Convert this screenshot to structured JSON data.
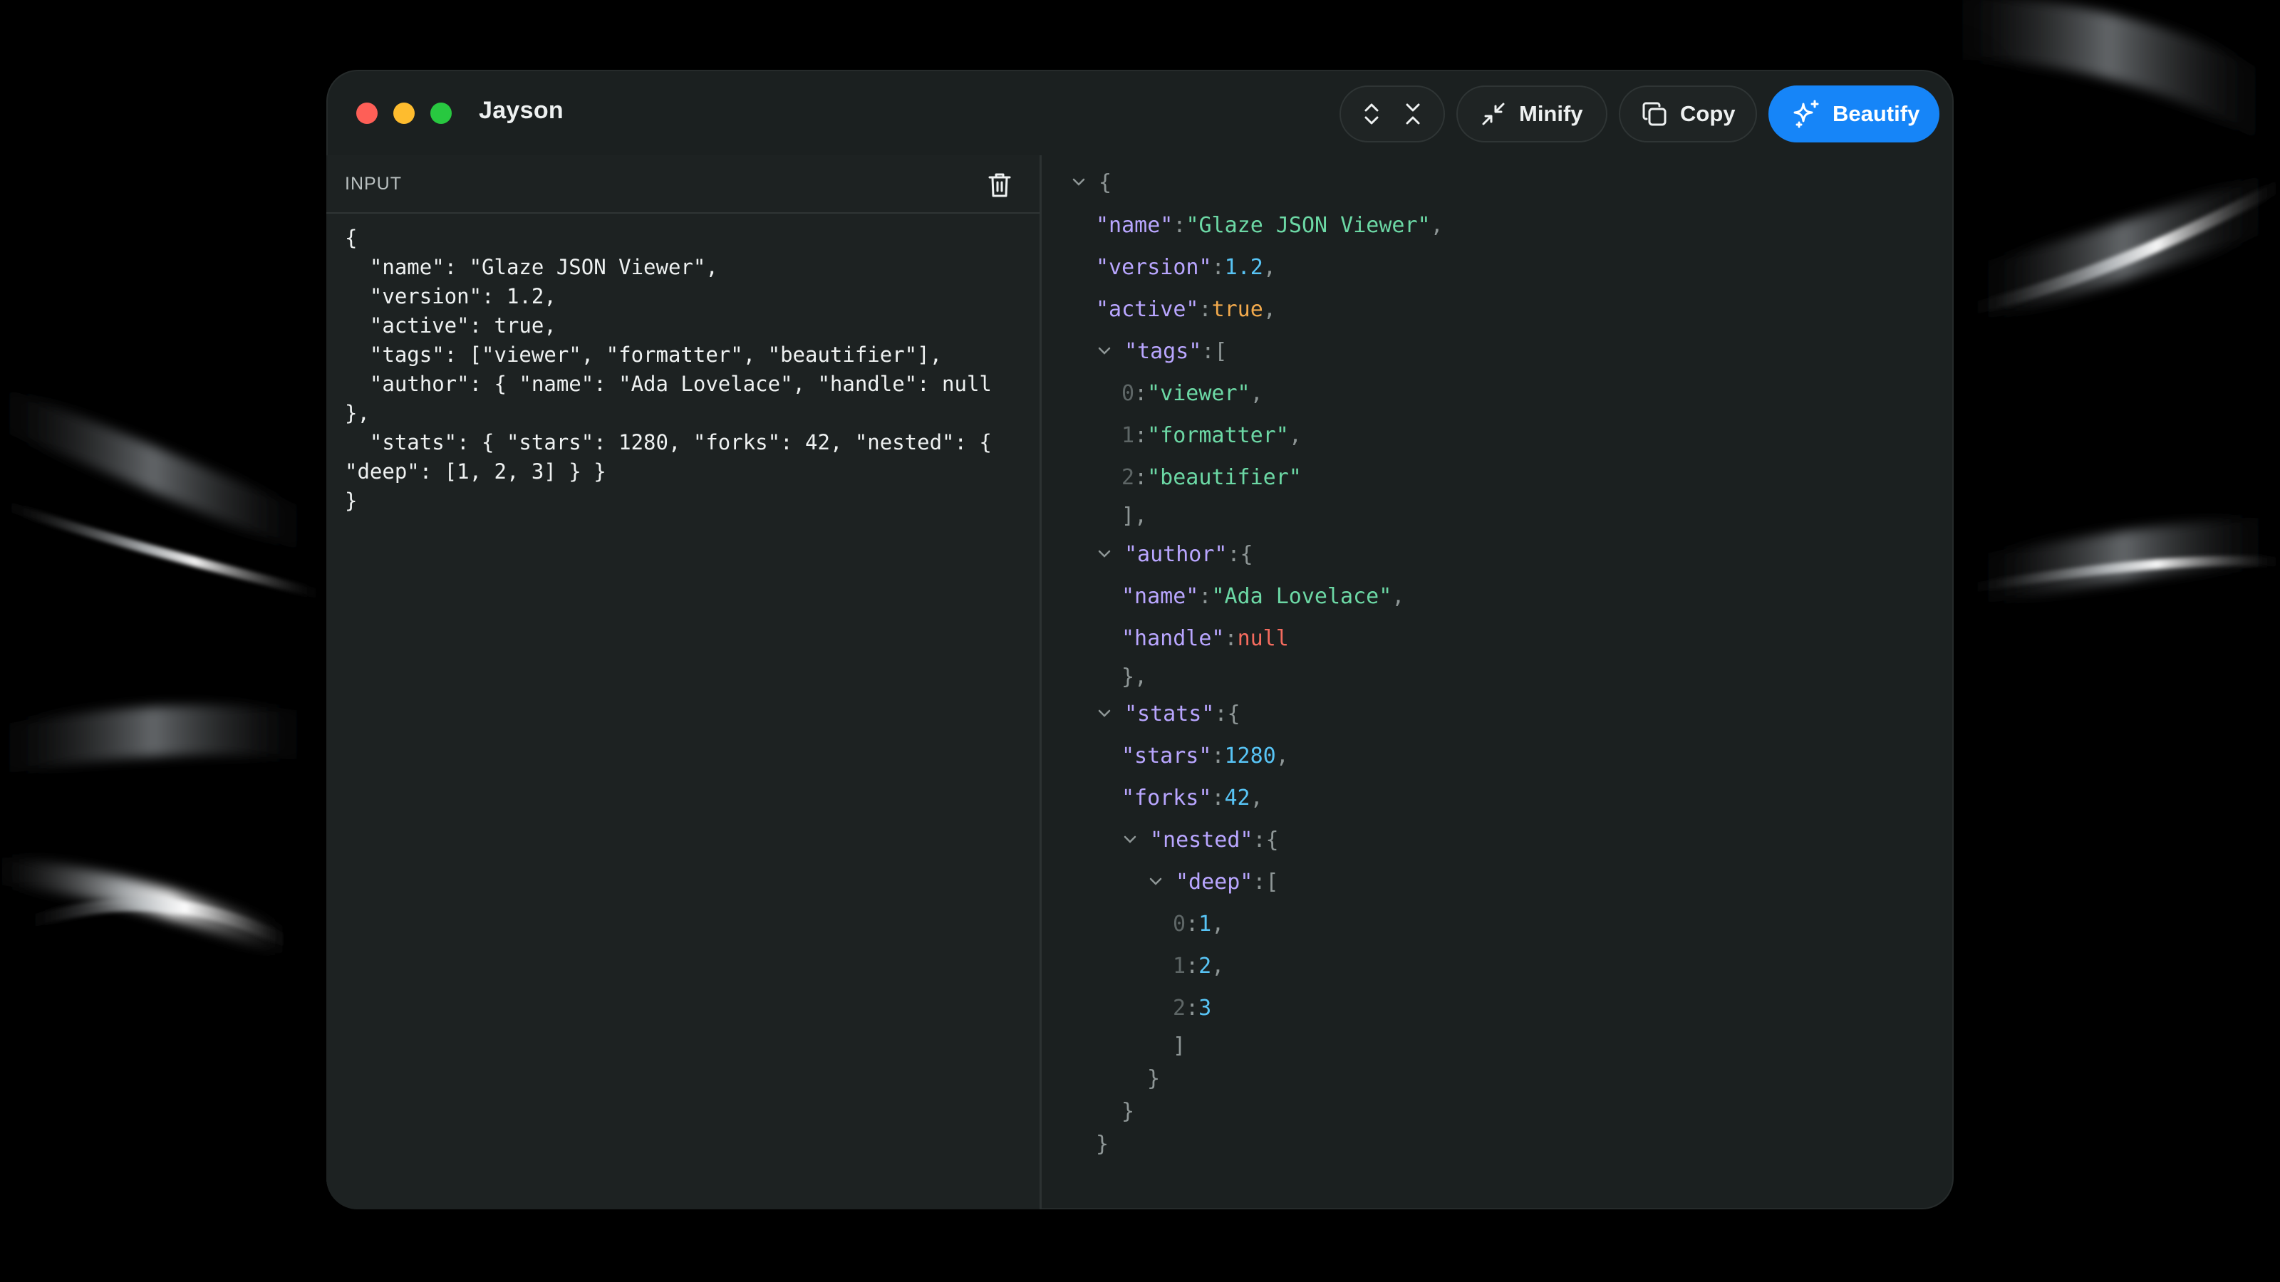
{
  "window": {
    "title": "Jayson"
  },
  "toolbar": {
    "expand_label": "",
    "minify_label": "Minify",
    "copy_label": "Copy",
    "beautify_label": "Beautify",
    "accent_color": "#1685f8"
  },
  "input": {
    "label": "INPUT",
    "text": "{\n  \"name\": \"Glaze JSON Viewer\",\n  \"version\": 1.2,\n  \"active\": true,\n  \"tags\": [\"viewer\", \"formatter\", \"beautifier\"],\n  \"author\": { \"name\": \"Ada Lovelace\", \"handle\": null },\n  \"stats\": { \"stars\": 1280, \"forks\": 42, \"nested\": { \"deep\": [1, 2, 3] } }\n}"
  },
  "tree": {
    "root_open": "{",
    "name_key": "\"name\"",
    "name_value": "\"Glaze JSON Viewer\"",
    "version_key": "\"version\"",
    "version_value": "1.2",
    "active_key": "\"active\"",
    "active_value": "true",
    "tags_key": "\"tags\"",
    "tags_items": [
      {
        "index": "0",
        "value": "\"viewer\""
      },
      {
        "index": "1",
        "value": "\"formatter\""
      },
      {
        "index": "2",
        "value": "\"beautifier\""
      }
    ],
    "author_key": "\"author\"",
    "author_name_key": "\"name\"",
    "author_name_value": "\"Ada Lovelace\"",
    "author_handle_key": "\"handle\"",
    "author_handle_value": "null",
    "stats_key": "\"stats\"",
    "stars_key": "\"stars\"",
    "stars_value": "1280",
    "forks_key": "\"forks\"",
    "forks_value": "42",
    "nested_key": "\"nested\"",
    "deep_key": "\"deep\"",
    "deep_items": [
      {
        "index": "0",
        "value": "1"
      },
      {
        "index": "1",
        "value": "2"
      },
      {
        "index": "2",
        "value": "3"
      }
    ],
    "root_close": "}"
  },
  "colors": {
    "key": "#b9a6ff",
    "string": "#6cd8a5",
    "number": "#58c4f5",
    "boolean": "#f2a94c",
    "null": "#f36b5e"
  }
}
